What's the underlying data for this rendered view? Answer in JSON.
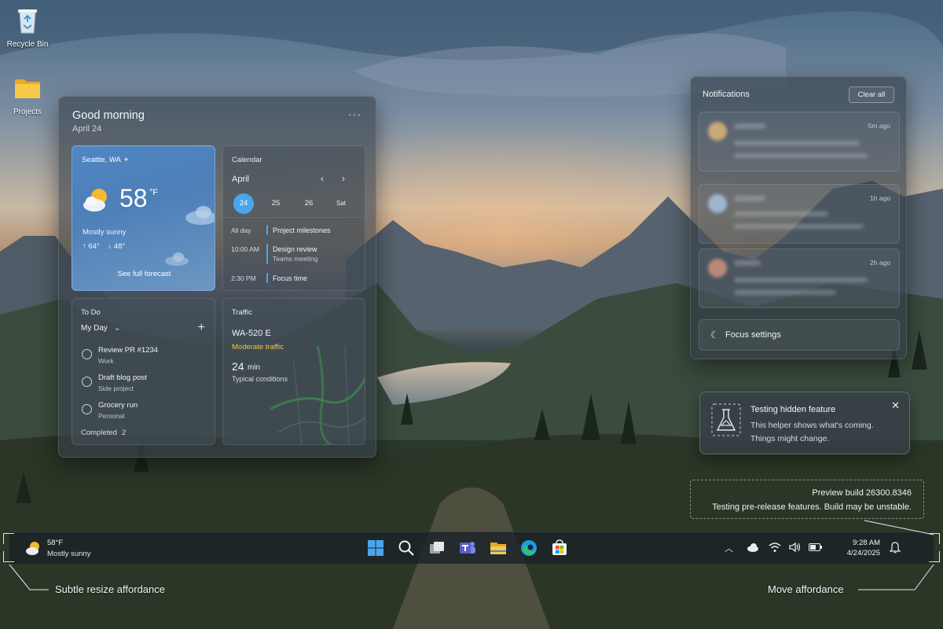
{
  "desktop": {
    "icons": [
      {
        "label": "Recycle Bin",
        "icon": "recycle-bin-icon"
      },
      {
        "label": "Projects",
        "icon": "folder-icon"
      }
    ]
  },
  "widgets": {
    "greeting": "Good morning",
    "date": "April 24",
    "more_glyph": "···",
    "weather": {
      "location": "Seattle, WA",
      "temp": "58",
      "unit": "°F",
      "condition": "Mostly sunny",
      "high": "↑ 64°",
      "low": "↓ 48°",
      "link": "See full forecast",
      "icon": "partly-sunny-icon"
    },
    "calendar": {
      "title": "Calendar",
      "month": "April",
      "days": [
        "24",
        "25",
        "26",
        "Sat"
      ],
      "selected_day": "24",
      "events": [
        {
          "time": "All day",
          "name": "Project milestones",
          "sub": ""
        },
        {
          "time": "10:00 AM",
          "name": "Design review",
          "sub": "Teams meeting"
        },
        {
          "time": "2:30 PM",
          "name": "Focus time",
          "sub": ""
        }
      ],
      "accent": "#4aa6ec"
    },
    "todo": {
      "title": "To Do",
      "list_name": "My Day",
      "items": [
        {
          "name": "Review PR #1234",
          "sub": "Work"
        },
        {
          "name": "Draft blog post",
          "sub": "Side project"
        },
        {
          "name": "Grocery run",
          "sub": "Personal"
        }
      ],
      "completed_label": "Completed",
      "completed_count": "2"
    },
    "traffic": {
      "title": "Traffic",
      "road": "WA-520 E",
      "status": "Moderate traffic",
      "status_color": "#f0c24b",
      "minutes": "24",
      "unit": "min",
      "conditions": "Typical conditions"
    }
  },
  "notifications": {
    "title": "Notifications",
    "clear_all": "Clear all",
    "items": [
      {
        "time": "5m ago"
      },
      {
        "time": "1h ago"
      },
      {
        "time": "2h ago"
      }
    ],
    "focus_settings": "Focus settings"
  },
  "teaching_tip": {
    "title": "Testing hidden feature",
    "body": "This helper shows what's coming. Things might change.",
    "icon": "flask-icon"
  },
  "watermark": {
    "line1": "Preview build 26300.8346",
    "line2": "Testing pre-release features. Build may be unstable."
  },
  "taskbar": {
    "weather_temp": "58°F",
    "weather_cond": "Mostly sunny",
    "apps": [
      "start-icon",
      "search-icon",
      "task-view-icon",
      "teams-icon",
      "file-explorer-icon",
      "edge-icon",
      "store-icon"
    ],
    "tray": [
      "chevron-up-icon",
      "cloud-icon",
      "wifi-icon",
      "volume-icon",
      "battery-icon"
    ],
    "time": "9:28 AM",
    "date": "4/24/2025"
  },
  "annotations": {
    "resize": "Subtle resize affordance",
    "move": "Move affordance"
  }
}
